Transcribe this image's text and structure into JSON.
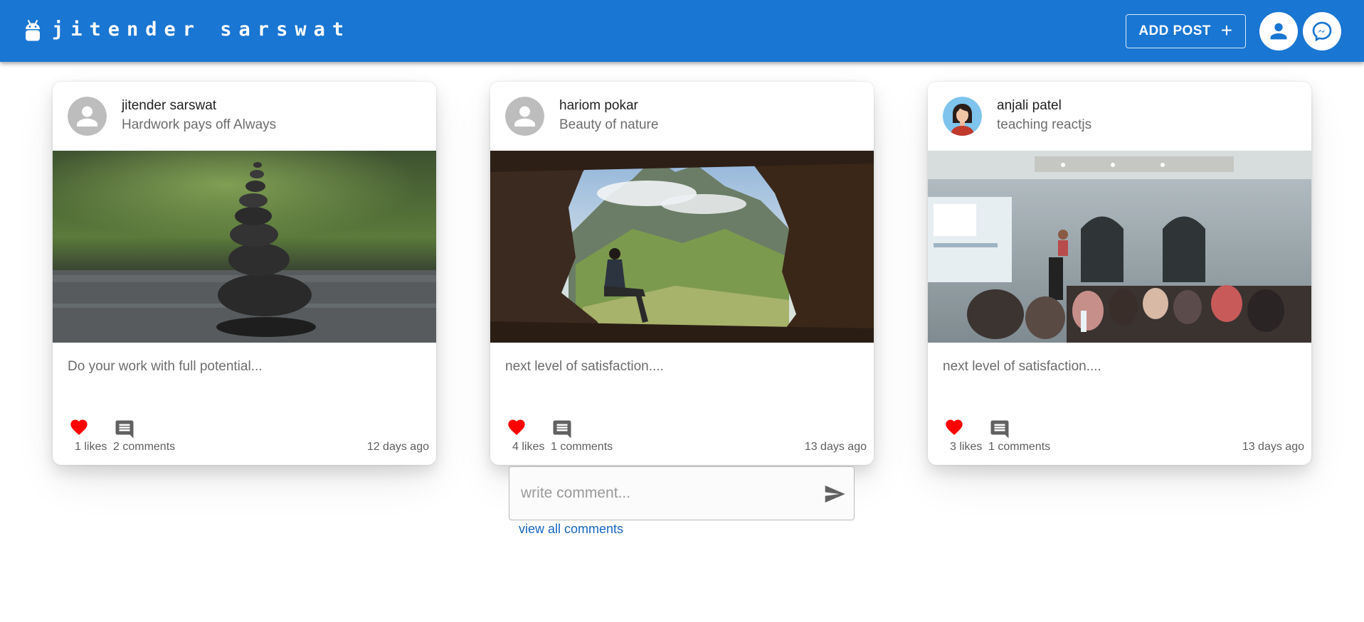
{
  "app": {
    "title": "jitender sarswat",
    "add_post_label": "ADD POST",
    "add_post_icon": "plus-icon",
    "profile_icon": "person-icon",
    "messenger_icon": "messenger-icon",
    "brand_color": "#1976d2"
  },
  "posts": [
    {
      "author": "jitender sarswat",
      "caption": "Hardwork pays off Always",
      "avatar": "default-avatar",
      "image": "stacked-stones-photo",
      "body": "Do your work with full potential...",
      "likes": "1 likes",
      "comments": "2 comments",
      "time": "12 days ago"
    },
    {
      "author": "hariom pokar",
      "caption": "Beauty of nature",
      "avatar": "default-avatar",
      "image": "mountain-cave-photo",
      "body": "next level of satisfaction....",
      "likes": "4 likes",
      "comments": "1 comments",
      "time": "13 days ago"
    },
    {
      "author": "anjali patel",
      "caption": "teaching reactjs",
      "avatar": "woman-avatar",
      "image": "classroom-photo",
      "body": "next level of satisfaction....",
      "likes": "3 likes",
      "comments": "1 comments",
      "time": "13 days ago"
    }
  ],
  "comment_form": {
    "placeholder": "write comment...",
    "value": "",
    "send_icon": "send-icon",
    "view_all_label": "view all comments"
  },
  "colors": {
    "like": "#ff0000",
    "link": "#1565c0"
  }
}
